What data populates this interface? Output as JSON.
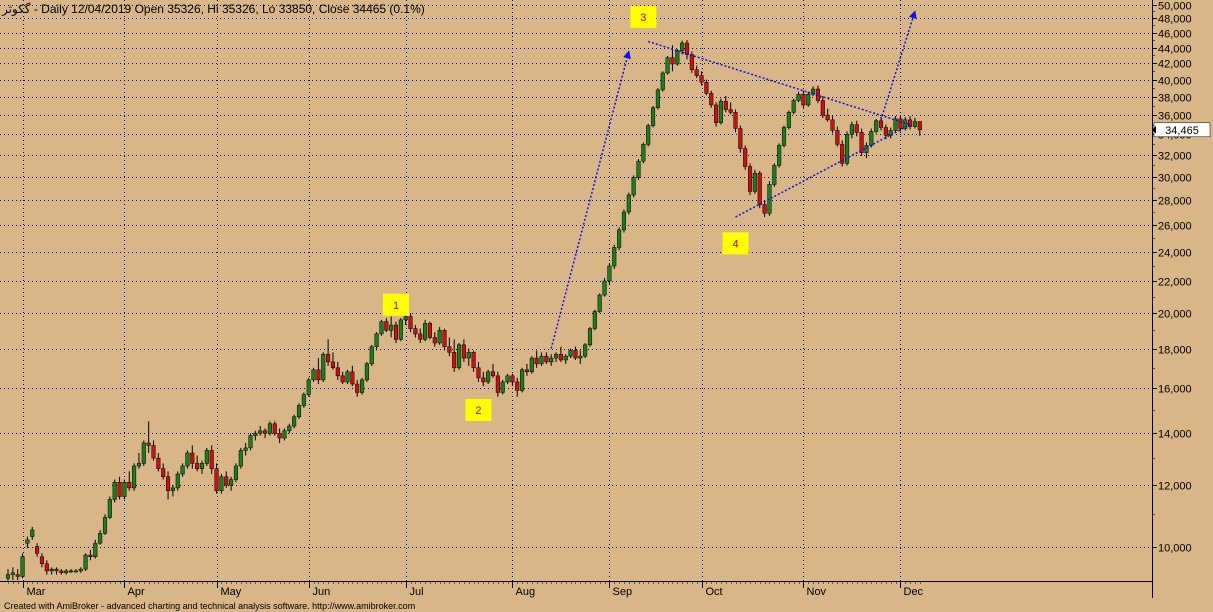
{
  "header": {
    "title": "گکوثر - Daily 12/04/2019 Open 35326, Hi 35326, Lo 33850, Close 34465 (0.1%)"
  },
  "footer": {
    "credit": "Created with AmiBroker - advanced charting and technical analysis software. http://www.amibroker.com"
  },
  "chart_data": {
    "type": "candlestick",
    "y_scale": "log",
    "ylim": [
      8900,
      50000
    ],
    "grid": true,
    "y_ticks": [
      10000,
      12000,
      14000,
      16000,
      18000,
      20000,
      22000,
      24000,
      26000,
      28000,
      30000,
      32000,
      34000,
      36000,
      38000,
      40000,
      42000,
      44000,
      46000,
      48000,
      50000
    ],
    "y_tick_labels": [
      "10,000",
      "12,000",
      "14,000",
      "16,000",
      "18,000",
      "20,000",
      "22,000",
      "24,000",
      "26,000",
      "28,000",
      "30,000",
      "32,000",
      "34,000",
      "36,000",
      "38,000",
      "40,000",
      "42,000",
      "44,000",
      "46,000",
      "48,000",
      "50,000"
    ],
    "x_months": [
      "Mar",
      "Apr",
      "May",
      "Jun",
      "Jul",
      "Aug",
      "Sep",
      "Oct",
      "Nov",
      "Dec"
    ],
    "last_price": 34465,
    "last_price_label": "34,465",
    "colors": {
      "up": "#1e7e1e",
      "down": "#cc1111",
      "trend": "#1010ee",
      "label_bg": "#ffff00",
      "label_text": "#cc0000",
      "last_bg": "#ffffff"
    },
    "annotations": [
      {
        "text": "1",
        "day": 80,
        "price": 20500
      },
      {
        "text": "2",
        "day": 97,
        "price": 15000
      },
      {
        "text": "3",
        "day": 131,
        "price": 48200
      },
      {
        "text": "4",
        "day": 150,
        "price": 24600
      }
    ],
    "trend_lines": [
      {
        "from": [
          112,
          18000
        ],
        "to": [
          128,
          43500
        ],
        "arrow": true
      },
      {
        "from": [
          132,
          44800
        ],
        "to": [
          186,
          35000
        ],
        "arrow": false
      },
      {
        "from": [
          150,
          26600
        ],
        "to": [
          186,
          35000
        ],
        "arrow": false
      },
      {
        "from": [
          180,
          35500
        ],
        "to": [
          187,
          49000
        ],
        "arrow": true
      }
    ],
    "candles": [
      [
        9100,
        9350,
        9000,
        9200
      ],
      [
        9200,
        9400,
        9050,
        9250
      ],
      [
        9200,
        9350,
        9050,
        9150
      ],
      [
        9150,
        9800,
        9100,
        9700
      ],
      [
        10100,
        10300,
        9950,
        10200
      ],
      [
        10300,
        10600,
        10200,
        10500
      ],
      [
        10000,
        10100,
        9700,
        9800
      ],
      [
        9700,
        9800,
        9400,
        9500
      ],
      [
        9500,
        9600,
        9200,
        9300
      ],
      [
        9300,
        9400,
        9200,
        9350
      ],
      [
        9350,
        9400,
        9200,
        9300
      ],
      [
        9300,
        9350,
        9200,
        9250
      ],
      [
        9250,
        9350,
        9200,
        9300
      ],
      [
        9300,
        9350,
        9250,
        9300
      ],
      [
        9300,
        9350,
        9250,
        9300
      ],
      [
        9300,
        9400,
        9250,
        9350
      ],
      [
        9350,
        9800,
        9300,
        9750
      ],
      [
        9750,
        9900,
        9600,
        9700
      ],
      [
        9700,
        10200,
        9650,
        10100
      ],
      [
        10100,
        10500,
        10050,
        10400
      ],
      [
        10400,
        11000,
        10350,
        10900
      ],
      [
        10900,
        11600,
        10850,
        11500
      ],
      [
        11500,
        12200,
        11400,
        12100
      ],
      [
        12100,
        12300,
        11500,
        11600
      ],
      [
        11600,
        12200,
        11500,
        12100
      ],
      [
        12100,
        12500,
        11800,
        11900
      ],
      [
        11900,
        12800,
        11800,
        12700
      ],
      [
        12700,
        13200,
        12600,
        12800
      ],
      [
        12800,
        13700,
        12700,
        13600
      ],
      [
        13600,
        14500,
        13200,
        13500
      ],
      [
        13500,
        13700,
        12900,
        13000
      ],
      [
        13000,
        13200,
        12500,
        12600
      ],
      [
        12600,
        12800,
        12200,
        12300
      ],
      [
        12300,
        12500,
        11500,
        11800
      ],
      [
        11800,
        12000,
        11600,
        11900
      ],
      [
        11900,
        12500,
        11800,
        12400
      ],
      [
        12400,
        12800,
        12300,
        12700
      ],
      [
        12700,
        13300,
        12600,
        13200
      ],
      [
        13200,
        13500,
        12600,
        12800
      ],
      [
        12800,
        13100,
        12500,
        12600
      ],
      [
        12600,
        12900,
        12400,
        12800
      ],
      [
        12800,
        13400,
        12700,
        13300
      ],
      [
        13300,
        13500,
        12400,
        12600
      ],
      [
        12600,
        12800,
        11700,
        11800
      ],
      [
        11800,
        12400,
        11700,
        12300
      ],
      [
        12300,
        12500,
        11900,
        12000
      ],
      [
        12000,
        12300,
        11800,
        12200
      ],
      [
        12200,
        12800,
        12100,
        12700
      ],
      [
        12700,
        13400,
        12600,
        13300
      ],
      [
        13300,
        13600,
        13100,
        13400
      ],
      [
        13400,
        14000,
        13300,
        13900
      ],
      [
        13900,
        14100,
        13700,
        14000
      ],
      [
        14000,
        14300,
        13900,
        14100
      ],
      [
        14100,
        14200,
        13800,
        14000
      ],
      [
        14000,
        14500,
        13900,
        14400
      ],
      [
        14400,
        14500,
        13900,
        14000
      ],
      [
        14000,
        14200,
        13600,
        13800
      ],
      [
        13800,
        14200,
        13700,
        14100
      ],
      [
        14100,
        14400,
        14000,
        14300
      ],
      [
        14300,
        14800,
        14200,
        14700
      ],
      [
        14700,
        15300,
        14600,
        15200
      ],
      [
        15200,
        15800,
        15100,
        15700
      ],
      [
        15700,
        16500,
        15600,
        16400
      ],
      [
        16400,
        17000,
        16300,
        16900
      ],
      [
        16900,
        17500,
        16200,
        16400
      ],
      [
        16400,
        17800,
        16300,
        17700
      ],
      [
        17700,
        18500,
        17100,
        17300
      ],
      [
        17300,
        17800,
        16900,
        17000
      ],
      [
        17000,
        17300,
        16400,
        16600
      ],
      [
        16600,
        16800,
        16200,
        16300
      ],
      [
        16300,
        16900,
        16200,
        16800
      ],
      [
        16800,
        17100,
        16100,
        16200
      ],
      [
        16200,
        16400,
        15600,
        15800
      ],
      [
        15800,
        16500,
        15700,
        16400
      ],
      [
        16400,
        17300,
        16300,
        17200
      ],
      [
        17200,
        18200,
        17100,
        18100
      ],
      [
        18100,
        18900,
        17900,
        18800
      ],
      [
        18800,
        19600,
        18700,
        19500
      ],
      [
        19500,
        19700,
        18900,
        19000
      ],
      [
        19000,
        19800,
        18600,
        19300
      ],
      [
        19300,
        19500,
        18300,
        18500
      ],
      [
        18500,
        19700,
        18400,
        19600
      ],
      [
        19600,
        20200,
        19300,
        19800
      ],
      [
        19800,
        20000,
        18900,
        19100
      ],
      [
        19100,
        19300,
        18600,
        18800
      ],
      [
        18800,
        19100,
        18300,
        18500
      ],
      [
        18500,
        19600,
        18400,
        19400
      ],
      [
        19400,
        19500,
        18500,
        18600
      ],
      [
        18600,
        18900,
        18100,
        18300
      ],
      [
        18300,
        19200,
        18200,
        19000
      ],
      [
        19000,
        19100,
        17900,
        18100
      ],
      [
        18100,
        18600,
        17600,
        17800
      ],
      [
        17800,
        18500,
        16800,
        17000
      ],
      [
        17000,
        18300,
        16900,
        18200
      ],
      [
        18200,
        18500,
        17300,
        17500
      ],
      [
        17500,
        18000,
        17100,
        17800
      ],
      [
        17800,
        17900,
        16800,
        17000
      ],
      [
        17000,
        17300,
        16300,
        16500
      ],
      [
        16500,
        16800,
        16100,
        16300
      ],
      [
        16300,
        16900,
        16200,
        16800
      ],
      [
        16800,
        17200,
        16500,
        16600
      ],
      [
        16600,
        16800,
        15600,
        15800
      ],
      [
        15800,
        16400,
        15700,
        16300
      ],
      [
        16300,
        16700,
        16200,
        16600
      ],
      [
        16600,
        16700,
        16100,
        16300
      ],
      [
        16300,
        16500,
        15600,
        15900
      ],
      [
        15900,
        17000,
        15800,
        16900
      ],
      [
        16900,
        17200,
        16600,
        16800
      ],
      [
        16800,
        17600,
        16700,
        17500
      ],
      [
        17500,
        17900,
        17000,
        17200
      ],
      [
        17200,
        17800,
        17100,
        17600
      ],
      [
        17600,
        17800,
        17200,
        17300
      ],
      [
        17300,
        17700,
        17100,
        17500
      ],
      [
        17500,
        17800,
        17300,
        17700
      ],
      [
        17700,
        18100,
        17300,
        17400
      ],
      [
        17400,
        17700,
        17200,
        17600
      ],
      [
        17600,
        18000,
        17500,
        17900
      ],
      [
        17900,
        18100,
        17400,
        17500
      ],
      [
        17500,
        17900,
        17200,
        17600
      ],
      [
        17600,
        18300,
        17500,
        18200
      ],
      [
        18200,
        19200,
        18100,
        19100
      ],
      [
        19100,
        20200,
        19000,
        20100
      ],
      [
        20100,
        21200,
        20000,
        21100
      ],
      [
        21100,
        22200,
        21000,
        22000
      ],
      [
        22000,
        23200,
        21800,
        23000
      ],
      [
        23000,
        24500,
        22800,
        24300
      ],
      [
        24300,
        25800,
        24100,
        25600
      ],
      [
        25600,
        27200,
        25400,
        27000
      ],
      [
        27000,
        28600,
        26800,
        28400
      ],
      [
        28400,
        30100,
        28200,
        29900
      ],
      [
        29900,
        31600,
        29700,
        31400
      ],
      [
        31400,
        33200,
        31200,
        33000
      ],
      [
        33000,
        35100,
        32800,
        34900
      ],
      [
        34900,
        37000,
        34700,
        36800
      ],
      [
        36800,
        39000,
        36600,
        38800
      ],
      [
        38800,
        41000,
        38600,
        40800
      ],
      [
        40800,
        42900,
        40600,
        42700
      ],
      [
        42700,
        44300,
        41000,
        41900
      ],
      [
        41900,
        43800,
        41700,
        43600
      ],
      [
        43600,
        44900,
        43100,
        44600
      ],
      [
        44600,
        45000,
        42500,
        43100
      ],
      [
        43100,
        43500,
        40800,
        41200
      ],
      [
        41200,
        41700,
        40200,
        40500
      ],
      [
        40500,
        41000,
        39300,
        39700
      ],
      [
        39700,
        40000,
        38200,
        38400
      ],
      [
        38400,
        38700,
        36800,
        37100
      ],
      [
        37100,
        37400,
        34800,
        35200
      ],
      [
        35200,
        37800,
        35000,
        37500
      ],
      [
        37500,
        38100,
        36300,
        36600
      ],
      [
        36600,
        37400,
        36100,
        36300
      ],
      [
        36300,
        36600,
        34200,
        34600
      ],
      [
        34600,
        34900,
        32200,
        32600
      ],
      [
        32600,
        32900,
        30600,
        30900
      ],
      [
        30900,
        31200,
        28400,
        28700
      ],
      [
        28700,
        30600,
        28500,
        30300
      ],
      [
        30300,
        30500,
        27300,
        27600
      ],
      [
        27600,
        27800,
        26600,
        26900
      ],
      [
        26900,
        29600,
        26700,
        29300
      ],
      [
        29300,
        31200,
        29100,
        31000
      ],
      [
        31000,
        33100,
        30800,
        32900
      ],
      [
        32900,
        34900,
        32700,
        34700
      ],
      [
        34700,
        36500,
        34500,
        36300
      ],
      [
        36300,
        37800,
        36100,
        37600
      ],
      [
        37600,
        38600,
        37400,
        38300
      ],
      [
        38300,
        38700,
        36800,
        37100
      ],
      [
        37100,
        38600,
        36900,
        38300
      ],
      [
        38300,
        39200,
        38100,
        38900
      ],
      [
        38900,
        39300,
        37300,
        37600
      ],
      [
        37600,
        38100,
        35700,
        36000
      ],
      [
        36000,
        36700,
        35300,
        35500
      ],
      [
        35500,
        35900,
        34100,
        34400
      ],
      [
        34400,
        34800,
        32800,
        33000
      ],
      [
        33000,
        33400,
        30900,
        31200
      ],
      [
        31200,
        34300,
        31000,
        34000
      ],
      [
        34000,
        35300,
        33600,
        35000
      ],
      [
        35000,
        35400,
        33800,
        34200
      ],
      [
        34200,
        34600,
        31900,
        32200
      ],
      [
        32200,
        33200,
        31700,
        32900
      ],
      [
        32900,
        34600,
        32700,
        34300
      ],
      [
        34300,
        35600,
        34100,
        35400
      ],
      [
        35400,
        35800,
        34400,
        34700
      ],
      [
        34700,
        35000,
        33500,
        33900
      ],
      [
        33900,
        34700,
        33600,
        34400
      ],
      [
        34400,
        35900,
        34200,
        35600
      ],
      [
        35600,
        35900,
        34300,
        34600
      ],
      [
        34600,
        35800,
        34400,
        35500
      ],
      [
        35500,
        35900,
        34500,
        34800
      ],
      [
        34800,
        35700,
        34600,
        35300
      ],
      [
        35326,
        35326,
        33850,
        34465
      ]
    ]
  }
}
